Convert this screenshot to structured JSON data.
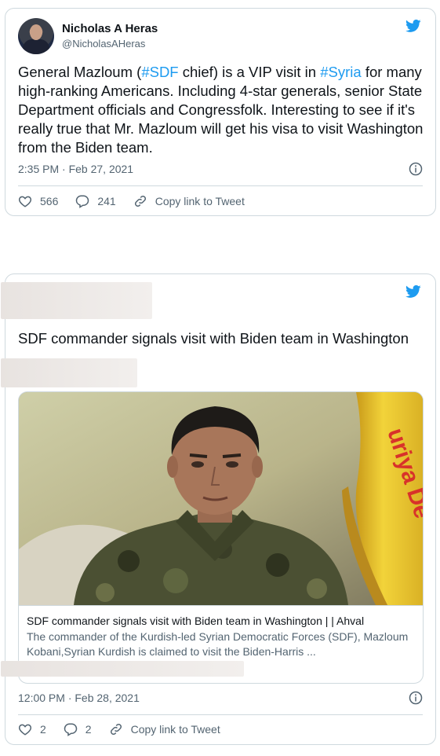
{
  "colors": {
    "accent": "#1d9bf0",
    "text": "#0f1419",
    "muted": "#536471",
    "border": "#cfd9de"
  },
  "tweet1": {
    "name": "Nicholas A Heras",
    "handle": "@NicholasAHeras",
    "text_parts": {
      "p1": "General Mazloum (",
      "tag1": "#SDF",
      "p2": " chief) is a VIP visit in ",
      "tag2": "#Syria",
      "p3": " for many high-ranking Americans. Including 4-star generals, senior State Department officials and Congressfolk. Interesting to see if it's really true that Mr. Mazloum will get his visa to visit Washington from the Biden team."
    },
    "timestamp": "2:35 PM · Feb 27, 2021",
    "likes": "566",
    "replies": "241",
    "copy_link": "Copy link to Tweet",
    "icons": [
      "twitter-bird-icon",
      "info-icon",
      "heart-icon",
      "reply-icon",
      "link-icon"
    ]
  },
  "tweet2": {
    "headline": "SDF commander signals visit with Biden team in Washington",
    "link_card": {
      "title": "SDF commander signals visit with Biden team in Washington | | Ahval",
      "description": "The commander of the Kurdish-led Syrian Democratic Forces (SDF), Mazloum Kobani,Syrian Kurdish is claimed to visit the Biden-Harris ...",
      "flag_text": "uriya De"
    },
    "timestamp": "12:00 PM · Feb 28, 2021",
    "likes": "2",
    "replies": "2",
    "copy_link": "Copy link to Tweet",
    "icons": [
      "twitter-bird-icon",
      "info-icon",
      "heart-icon",
      "reply-icon",
      "link-icon"
    ]
  }
}
